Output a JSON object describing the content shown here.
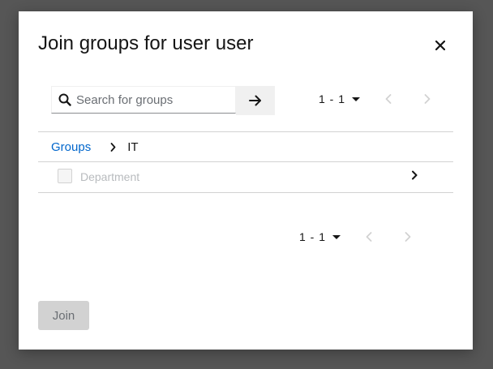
{
  "modal": {
    "title": "Join groups for user user",
    "close_icon": "close-icon"
  },
  "search": {
    "placeholder": "Search for groups",
    "value": "",
    "search_icon": "search-icon",
    "submit_icon": "arrow-right-icon"
  },
  "pagination_top": {
    "range": "1 - 1",
    "prev_icon": "chevron-left-icon",
    "next_icon": "chevron-right-icon"
  },
  "breadcrumb": {
    "root": "Groups",
    "separator_icon": "chevron-right-icon",
    "current": "IT"
  },
  "groups": [
    {
      "name": "Department",
      "checked": false,
      "disabled": true
    }
  ],
  "pagination_bottom": {
    "range": "1 - 1",
    "prev_icon": "chevron-left-icon",
    "next_icon": "chevron-right-icon"
  },
  "footer": {
    "join_label": "Join",
    "join_disabled": true
  },
  "colors": {
    "link": "#0066cc",
    "disabled_text": "#b8bbbe",
    "disabled_button_bg": "#d2d2d2",
    "backdrop": "#565656"
  }
}
